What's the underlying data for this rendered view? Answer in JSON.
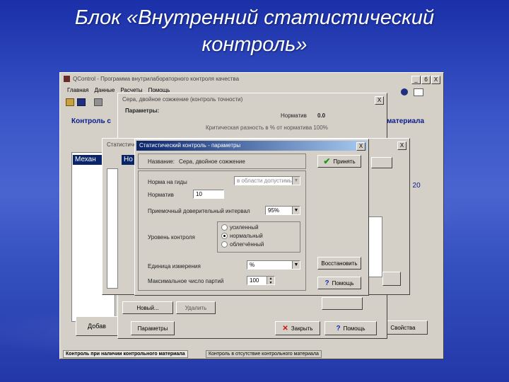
{
  "slide": {
    "title_line1": "Блок «Внутренний статистический",
    "title_line2": "контроль»"
  },
  "main_window": {
    "title": "QControl - Программа внутрилабораторного контроля качества",
    "min": "_",
    "max": "б",
    "close": "X",
    "menu": [
      "Главная",
      "Данные",
      "Расчеты",
      "Помощь"
    ],
    "heading_left": "Контроль с",
    "heading_right": "материала",
    "list_selected": "Механ",
    "value_label": "s: 20",
    "add_button": "Добав",
    "props_button": "Свойства",
    "tabs": [
      "Контроль при наличии контрольного материала",
      "Контроль в отсутствие контрольного материала"
    ]
  },
  "params_window": {
    "title": "Сера, двойное сожжение (контроль точности)",
    "close": "X",
    "label": "Параметры:",
    "norm_label": "Норматив",
    "norm_value": "0.0",
    "line2": "Критическая разность в % от норматива 100%",
    "new_button": "Новый...",
    "delete_button": "Удалить",
    "params_button": "Параметры",
    "close_button": "Закрыть",
    "help_button": "Помощь"
  },
  "stat_window": {
    "title": "Статистический контроль",
    "close": "X",
    "list_item": "Но"
  },
  "dialog": {
    "title": "Статистический контроль - параметры",
    "close": "X",
    "name_label": "Название:",
    "name_value": "Сера, двойное сожжение",
    "norm_type_label": "Норма на гиды",
    "norm_type_value": "в области допустимых",
    "norm_label": "Норматив",
    "norm_value": "10",
    "deviation_label": "Приемочный доверительный интервал",
    "deviation_value": "95%",
    "level_label": "Уровень контроля",
    "levels": [
      "усиленный",
      "нормальный",
      "облегчённый"
    ],
    "unit_label": "Единица измерения",
    "unit_value": "%",
    "max_label": "Максимальное число партий",
    "max_value": "100",
    "accept_button": "Принять",
    "restore_button": "Восстановить",
    "help_button": "Помощь"
  },
  "colors": {
    "accent_title": "#0a246a",
    "ok_green": "#1a9a1a",
    "cancel_red": "#d01010",
    "help_blue": "#1030c0"
  }
}
